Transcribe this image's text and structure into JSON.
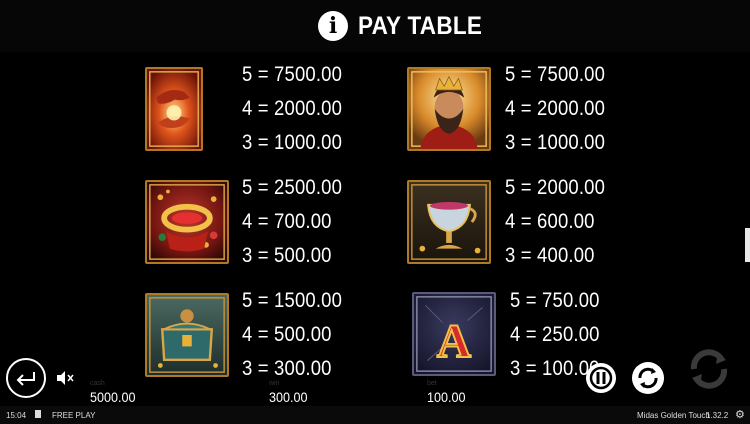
{
  "header": {
    "title": "PAY TABLE",
    "info_glyph": "i"
  },
  "symbols": [
    {
      "id": "golden-touch",
      "icon": "golden-hand-icon",
      "pays": [
        "5 = 7500.00",
        "4 = 2000.00",
        "3 = 1000.00"
      ]
    },
    {
      "id": "king-midas",
      "icon": "king-icon",
      "pays": [
        "5 = 7500.00",
        "4 = 2000.00",
        "3 = 1000.00"
      ]
    },
    {
      "id": "crown",
      "icon": "crown-icon",
      "pays": [
        "5 = 2500.00",
        "4 = 700.00",
        "3 = 500.00"
      ]
    },
    {
      "id": "goblet",
      "icon": "goblet-icon",
      "pays": [
        "5 = 2000.00",
        "4 = 600.00",
        "3 = 400.00"
      ]
    },
    {
      "id": "treasure-chest",
      "icon": "chest-icon",
      "pays": [
        "5 = 1500.00",
        "4 = 500.00",
        "3 = 300.00"
      ]
    },
    {
      "id": "letter-a",
      "icon": "letter-a-icon",
      "letter": "A",
      "pays": [
        "5 = 750.00",
        "4 = 250.00",
        "3 = 100.00"
      ]
    }
  ],
  "footer": {
    "balance": {
      "label": "cash",
      "value": "5000.00"
    },
    "win": {
      "label": "win",
      "value": "300.00"
    },
    "bet": {
      "label": "bet",
      "value": "100.00"
    },
    "time": "15:04",
    "mode": "FREE PLAY",
    "game_name": "Midas Golden Touch",
    "version": "1.32.2"
  },
  "colors": {
    "gold_border": "#b07a22",
    "background": "#000000",
    "text": "#ffffff"
  }
}
